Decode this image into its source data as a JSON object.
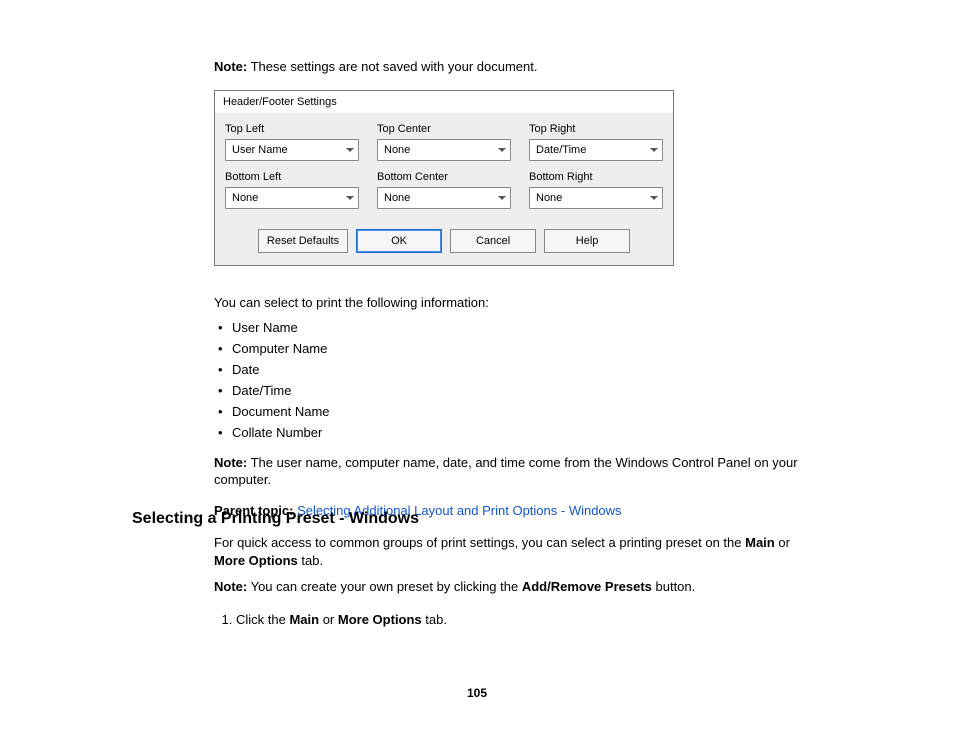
{
  "note_top": {
    "label": "Note:",
    "text": " These settings are not saved with your document."
  },
  "dialog": {
    "title": "Header/Footer Settings",
    "fields": {
      "top_left": {
        "label": "Top Left",
        "value": "User Name"
      },
      "top_center": {
        "label": "Top Center",
        "value": "None"
      },
      "top_right": {
        "label": "Top Right",
        "value": "Date/Time"
      },
      "bottom_left": {
        "label": "Bottom Left",
        "value": "None"
      },
      "bottom_center": {
        "label": "Bottom Center",
        "value": "None"
      },
      "bottom_right": {
        "label": "Bottom Right",
        "value": "None"
      }
    },
    "buttons": {
      "reset": "Reset Defaults",
      "ok": "OK",
      "cancel": "Cancel",
      "help": "Help"
    }
  },
  "body": {
    "intro_list": "You can select to print the following information:",
    "items": [
      "User Name",
      "Computer Name",
      "Date",
      "Date/Time",
      "Document Name",
      "Collate Number"
    ],
    "note2_label": "Note:",
    "note2_text": " The user name, computer name, date, and time come from the Windows Control Panel on your computer.",
    "parent_label": "Parent topic:",
    "parent_link": "Selecting Additional Layout and Print Options - Windows"
  },
  "section": {
    "heading": "Selecting a Printing Preset - Windows",
    "p1_pre": "For quick access to common groups of print settings, you can select a printing preset on the ",
    "p1_b1": "Main",
    "p1_mid": " or ",
    "p1_b2": "More Options",
    "p1_post": " tab.",
    "note_label": "Note:",
    "note_pre": " You can create your own preset by clicking the ",
    "note_b": "Add/Remove Presets",
    "note_post": " button.",
    "step1_pre": "Click the ",
    "step1_b1": "Main",
    "step1_mid": " or ",
    "step1_b2": "More Options",
    "step1_post": " tab."
  },
  "page_number": "105"
}
